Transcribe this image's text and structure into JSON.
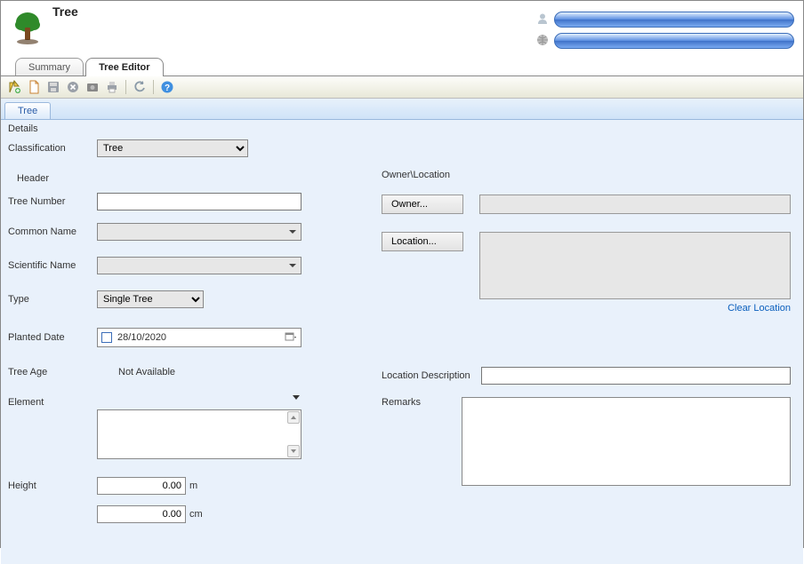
{
  "header": {
    "title": "Tree"
  },
  "tabs_main": [
    {
      "label": "Summary",
      "active": false
    },
    {
      "label": "Tree Editor",
      "active": true
    }
  ],
  "toolbar": {
    "icons": [
      "new",
      "doc",
      "save",
      "cancel",
      "photo",
      "print",
      "refresh",
      "help"
    ]
  },
  "inner_tabs": [
    {
      "label": "Tree",
      "active": true
    }
  ],
  "details": {
    "section_label": "Details",
    "classification_label": "Classification",
    "classification_value": "Tree",
    "header_section": "Header",
    "tree_number_label": "Tree Number",
    "tree_number_value": "",
    "common_name_label": "Common Name",
    "common_name_value": "",
    "scientific_name_label": "Scientific Name",
    "scientific_name_value": "",
    "type_label": "Type",
    "type_value": "Single Tree",
    "planted_date_label": "Planted Date",
    "planted_date_value": "28/10/2020",
    "tree_age_label": "Tree Age",
    "tree_age_value": "Not Available",
    "element_label": "Element",
    "element_value": "",
    "height_label": "Height",
    "height_value": "0.00",
    "height_unit": "m",
    "width_label": "",
    "width_value": "0.00",
    "width_unit": "cm"
  },
  "owner_location": {
    "section_label": "Owner\\Location",
    "owner_button": "Owner...",
    "owner_value": "",
    "location_button": "Location...",
    "location_value": "",
    "clear_location_link": "Clear Location",
    "location_description_label": "Location Description",
    "location_description_value": "",
    "remarks_label": "Remarks",
    "remarks_value": ""
  }
}
